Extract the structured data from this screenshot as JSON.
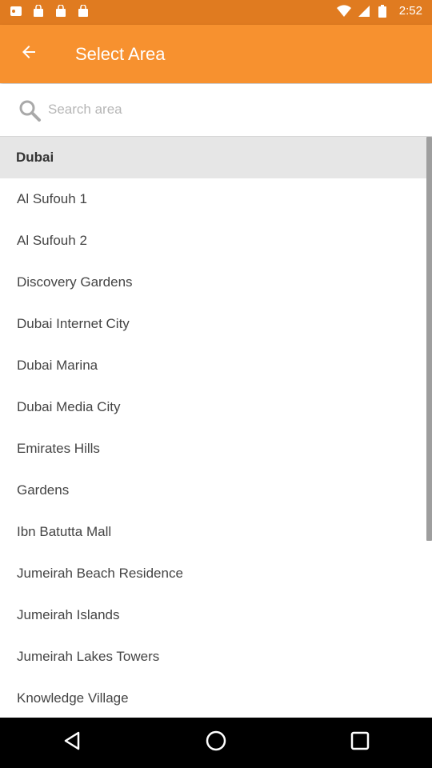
{
  "status_bar": {
    "time": "2:52",
    "icons": [
      "notification-icon",
      "bag-icon",
      "bag-icon",
      "bag-icon",
      "wifi-icon",
      "signal-icon",
      "battery-icon"
    ]
  },
  "app_bar": {
    "title": "Select Area",
    "back_icon": "arrow-back-icon"
  },
  "search": {
    "placeholder": "Search area",
    "value": ""
  },
  "list": {
    "section_header": "Dubai",
    "items": [
      "Al Sufouh 1",
      "Al Sufouh 2",
      "Discovery Gardens",
      "Dubai Internet City",
      "Dubai Marina",
      "Dubai Media City",
      "Emirates Hills",
      "Gardens",
      "Ibn Batutta Mall",
      "Jumeirah Beach Residence",
      "Jumeirah Islands",
      "Jumeirah Lakes Towers",
      "Knowledge Village"
    ]
  },
  "nav_bar": {
    "buttons": [
      "back-triangle-icon",
      "home-circle-icon",
      "recents-square-icon"
    ]
  },
  "colors": {
    "accent": "#f7912f",
    "status_bar": "#e07b20",
    "section_bg": "#e6e6e6"
  }
}
